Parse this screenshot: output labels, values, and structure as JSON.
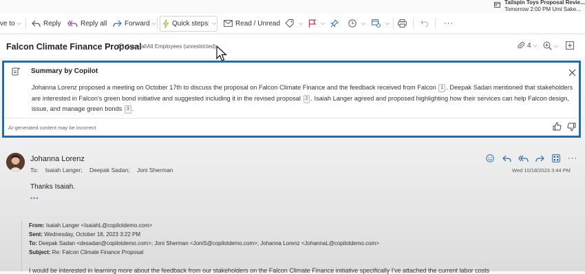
{
  "reminder": {
    "title": "Tailspin Toys Proposal Revie...",
    "detail": "Tomorrow 2:00 PM Umi Sake..."
  },
  "toolbar": {
    "move_to": "ve to",
    "reply": "Reply",
    "reply_all": "Reply all",
    "forward": "Forward",
    "quick_steps": "Quick steps",
    "read_unread": "Read / Unread",
    "more": "···"
  },
  "subject_bar": {
    "subject": "Falcon Climate Finance Proposal",
    "sensitivity": "General\\All Employees (unrestricted)",
    "attachment_count": "4"
  },
  "copilot": {
    "title": "Summary by Copilot",
    "seg1": "Johanna Lorenz proposed a meeting on October 17th to discuss the proposal on Falcon Climate Finance and the feedback received from Falcon",
    "ref1": "1",
    "seg2": ". Deepak Sadan mentioned that stakeholders are interested in Falcon's green bond initiative and suggested including it in the revised proposal",
    "ref2": "2",
    "seg3": ". Isaiah Langer agreed and proposed highlighting how their services can help Falcon design, issue, and manage green bonds",
    "ref3": "3",
    "seg4": ".",
    "disclaimer": "AI-generated content may be incorrect"
  },
  "message": {
    "sender": "Johanna Lorenz",
    "to_label": "To:",
    "recipients": [
      "Isaiah Langer;",
      "Deepak Sadan;",
      "Joni Sherman"
    ],
    "datetime": "Wed 10/18/2023 3:44 PM",
    "body": "Thanks Isaiah.",
    "expand": "•••",
    "quoted": {
      "from_label": "From:",
      "from": "Isaiah Langer <IsaiahL@copilotdemo.com>",
      "sent_label": "Sent:",
      "sent": "Wednesday, October 18, 2023 3:22 PM",
      "to_label": "To:",
      "to": "Deepak Sadan <desadan@copilotdemo.com>; Joni Sherman <JoniS@copilotdemo.com>; Johanna Lorenz <JohannaL@copilotdemo.com>",
      "subject_label": "Subject:",
      "subject": "Re: Falcon Climate Finance Proposal",
      "cutoff": "I would be interested in learning more about the feedback from our stakeholders on the Falcon Climate Finance initiative specifically I've attached the current labor costs"
    }
  },
  "colors": {
    "accent": "#1c6fb6",
    "icon_blue": "#2b6cb0",
    "flag_red": "#c4314b"
  },
  "icons": [
    "calendar-icon",
    "reply-icon",
    "reply-all-icon",
    "forward-icon",
    "lightning-icon",
    "envelope-icon",
    "tag-icon",
    "flag-icon",
    "pin-icon",
    "clock-icon",
    "rule-icon",
    "print-icon",
    "undo-icon",
    "shield-icon",
    "paperclip-icon",
    "zoom-icon",
    "popout-icon",
    "copilot-icon",
    "close-icon",
    "thumbs-up-icon",
    "thumbs-down-icon",
    "emoji-icon",
    "apps-icon",
    "cursor-icon"
  ]
}
